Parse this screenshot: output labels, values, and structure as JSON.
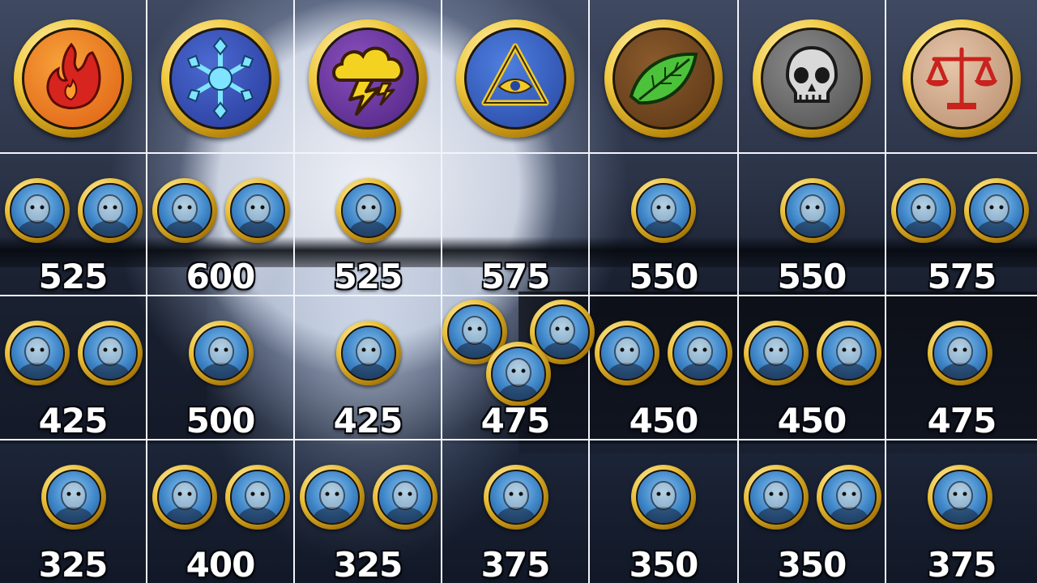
{
  "schools": [
    {
      "name": "fire",
      "colors": [
        "#f7a23a",
        "#de5d12"
      ],
      "icon": "flame-icon"
    },
    {
      "name": "ice",
      "colors": [
        "#4b6ad0",
        "#27399a"
      ],
      "icon": "snowflake-icon"
    },
    {
      "name": "storm",
      "colors": [
        "#8a4fbd",
        "#4e2482"
      ],
      "icon": "storm-cloud-icon"
    },
    {
      "name": "myth",
      "colors": [
        "#4e7fe0",
        "#2746a0"
      ],
      "icon": "eye-triangle-icon"
    },
    {
      "name": "life",
      "colors": [
        "#8a5a2c",
        "#5a3616"
      ],
      "icon": "leaf-icon"
    },
    {
      "name": "death",
      "colors": [
        "#8c8c8c",
        "#4e4e4e"
      ],
      "icon": "skull-icon"
    },
    {
      "name": "balance",
      "colors": [
        "#e6c6aa",
        "#b88c6e"
      ],
      "icon": "scales-icon"
    }
  ],
  "tiers": [
    {
      "values": [
        "525",
        "600",
        "525",
        "575",
        "550",
        "550",
        "575"
      ],
      "portraits": [
        [
          "dark-knight-portrait-icon",
          "cyclops-portrait-icon"
        ],
        [
          "ice-golem-portrait-icon",
          "wolf-warrior-portrait-icon"
        ],
        [
          "wolf-storm-portrait-icon"
        ],
        [],
        [
          "green-troll-portrait-icon"
        ],
        [
          "skeleton-warrior-portrait-icon"
        ],
        [
          "bear-brawler-portrait-icon",
          "gladiator-portrait-icon"
        ]
      ]
    },
    {
      "values": [
        "425",
        "500",
        "425",
        "475",
        "450",
        "450",
        "475"
      ],
      "portraits": [
        [
          "bear-pirate-portrait-icon",
          "minotaur-portrait-icon"
        ],
        [
          "mech-gunner-portrait-icon"
        ],
        [
          "mech-scout-portrait-icon"
        ],
        [
          "golden-dragon-portrait-icon",
          "yak-warrior-portrait-icon",
          "frog-mage-portrait-icon"
        ],
        [
          "orc-warrior-portrait-icon",
          "bat-demon-portrait-icon"
        ],
        [
          "armored-hippo-portrait-icon",
          "gold-dragon-portrait-icon"
        ],
        [
          "kraken-portrait-icon"
        ]
      ]
    },
    {
      "values": [
        "325",
        "400",
        "325",
        "375",
        "350",
        "350",
        "375"
      ],
      "portraits": [
        [
          "elf-boy-portrait-icon"
        ],
        [
          "ice-elf-portrait-icon",
          "ice-fairy-portrait-icon"
        ],
        [
          "rat-mage-portrait-icon",
          "goblin-wizard-portrait-icon"
        ],
        [
          "hooded-bear-portrait-icon"
        ],
        [
          "pixie-portrait-icon"
        ],
        [
          "dark-bear-portrait-icon",
          "undead-maiden-portrait-icon"
        ],
        [
          "fairy-queen-portrait-icon"
        ]
      ]
    }
  ]
}
